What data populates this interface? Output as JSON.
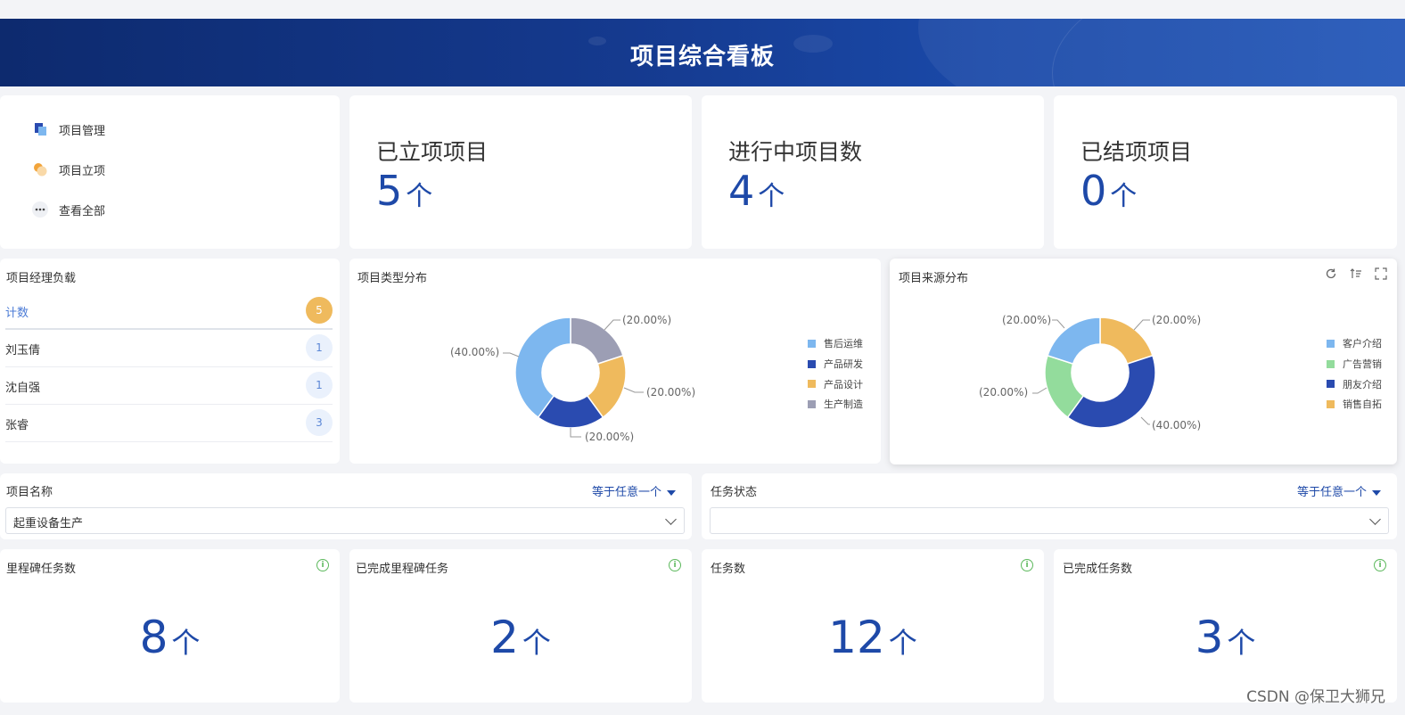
{
  "banner": {
    "title": "项目综合看板"
  },
  "quick_links": [
    {
      "label": "项目管理",
      "icon": "project-manage-icon"
    },
    {
      "label": "项目立项",
      "icon": "project-initiate-icon"
    },
    {
      "label": "查看全部",
      "icon": "more-icon"
    }
  ],
  "stats": [
    {
      "label": "已立项项目",
      "value": "5",
      "unit": "个"
    },
    {
      "label": "进行中项目数",
      "value": "4",
      "unit": "个"
    },
    {
      "label": "已结项项目",
      "value": "0",
      "unit": "个"
    }
  ],
  "manager_load": {
    "title": "项目经理负载",
    "total_label": "计数",
    "total_value": "5",
    "rows": [
      {
        "name": "刘玉倩",
        "count": "1"
      },
      {
        "name": "沈自强",
        "count": "1"
      },
      {
        "name": "张睿",
        "count": "3"
      }
    ]
  },
  "type_chart": {
    "title": "项目类型分布",
    "legend": [
      "售后运维",
      "产品研发",
      "产品设计",
      "生产制造"
    ],
    "colors": [
      "#7db7ef",
      "#2a4bb0",
      "#efba5d",
      "#9c9eb4"
    ],
    "labels": [
      "(40.00%)",
      "(20.00%)",
      "(20.00%)",
      "(20.00%)"
    ]
  },
  "source_chart": {
    "title": "项目来源分布",
    "legend": [
      "客户介绍",
      "广告营销",
      "朋友介绍",
      "销售自拓"
    ],
    "colors": [
      "#7db7ef",
      "#93dc9c",
      "#2a4bb0",
      "#efba5d"
    ],
    "labels": [
      "(20.00%)",
      "(20.00%)",
      "(40.00%)",
      "(20.00%)"
    ]
  },
  "chart_data": [
    {
      "type": "pie",
      "title": "项目类型分布",
      "categories": [
        "售后运维",
        "产品研发",
        "产品设计",
        "生产制造"
      ],
      "values": [
        40,
        20,
        20,
        20
      ]
    },
    {
      "type": "pie",
      "title": "项目来源分布",
      "categories": [
        "客户介绍",
        "广告营销",
        "朋友介绍",
        "销售自拓"
      ],
      "values": [
        20,
        20,
        40,
        20
      ]
    }
  ],
  "filters": [
    {
      "label": "项目名称",
      "mode": "等于任意一个",
      "value": "起重设备生产"
    },
    {
      "label": "任务状态",
      "mode": "等于任意一个",
      "value": ""
    }
  ],
  "kpis": [
    {
      "title": "里程碑任务数",
      "value": "8",
      "unit": "个"
    },
    {
      "title": "已完成里程碑任务",
      "value": "2",
      "unit": "个"
    },
    {
      "title": "任务数",
      "value": "12",
      "unit": "个"
    },
    {
      "title": "已完成任务数",
      "value": "3",
      "unit": "个"
    }
  ],
  "watermark": "CSDN @保卫大狮兄"
}
